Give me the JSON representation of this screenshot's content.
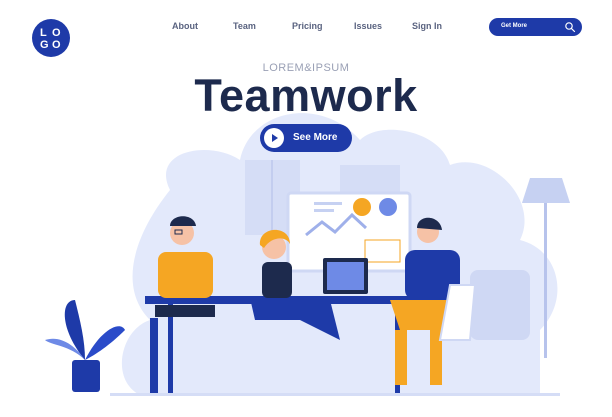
{
  "header": {
    "logo_letters": [
      "L",
      "O",
      "G",
      "O"
    ],
    "nav": [
      {
        "label": "About"
      },
      {
        "label": "Team"
      },
      {
        "label": "Pricing"
      },
      {
        "label": "Issues"
      },
      {
        "label": "Sign In"
      }
    ],
    "cta_label": "Get More",
    "cta_icon": "search-icon"
  },
  "hero": {
    "eyebrow": "LOREM&IPSUM",
    "title": "Teamwork",
    "button_label": "See More",
    "button_icon": "play-icon"
  },
  "colors": {
    "brand_blue": "#1e3aa8",
    "navy_text": "#1d2a4d",
    "accent_orange": "#f5a623",
    "blob": "#e3e9fb",
    "blob_dark": "#cfd8f4"
  }
}
